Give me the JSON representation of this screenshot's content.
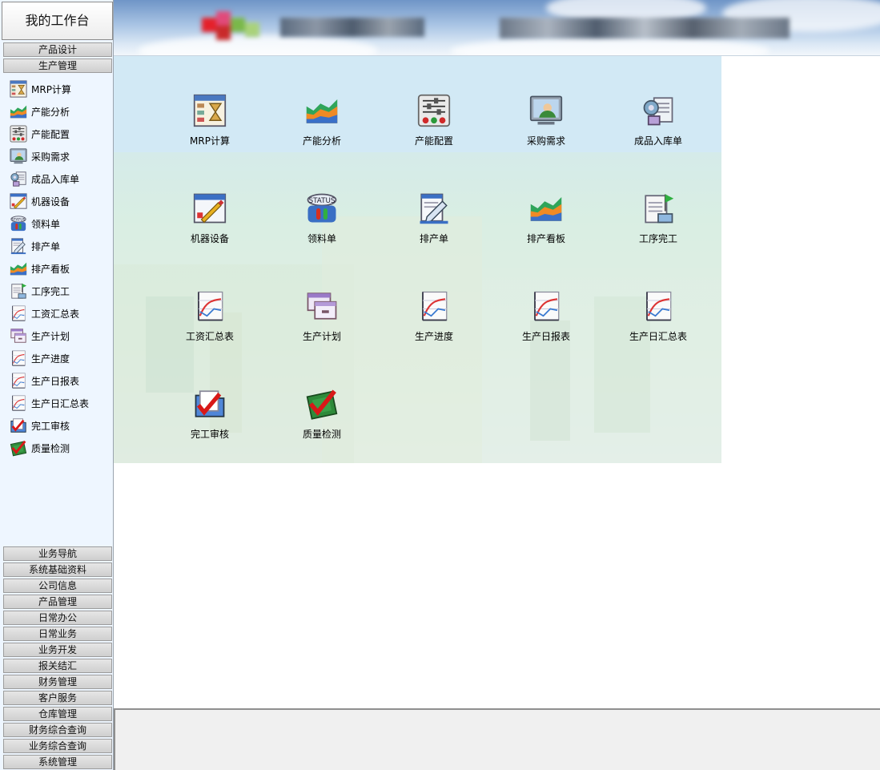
{
  "workbench": {
    "title": "我的工作台"
  },
  "top_categories": [
    "产品设计",
    "生产管理"
  ],
  "bottom_categories": [
    "业务导航",
    "系统基础资料",
    "公司信息",
    "产品管理",
    "日常办公",
    "日常业务",
    "业务开发",
    "报关结汇",
    "财务管理",
    "客户服务",
    "仓库管理",
    "财务综合查询",
    "业务综合查询",
    "系统管理"
  ],
  "sidebar": {
    "items": [
      {
        "label": "MRP计算",
        "icon": "hourglass-report-icon"
      },
      {
        "label": "产能分析",
        "icon": "area-chart-icon"
      },
      {
        "label": "产能配置",
        "icon": "sliders-icon"
      },
      {
        "label": "采购需求",
        "icon": "user-monitor-icon"
      },
      {
        "label": "成品入库单",
        "icon": "warehouse-doc-icon"
      },
      {
        "label": "机器设备",
        "icon": "pen-window-icon"
      },
      {
        "label": "领料单",
        "icon": "status-icon"
      },
      {
        "label": "排产单",
        "icon": "edit-doc-icon"
      },
      {
        "label": "排产看板",
        "icon": "area-chart-icon"
      },
      {
        "label": "工序完工",
        "icon": "flag-doc-icon"
      },
      {
        "label": "工资汇总表",
        "icon": "line-chart-icon"
      },
      {
        "label": "生产计划",
        "icon": "window-stack-icon"
      },
      {
        "label": "生产进度",
        "icon": "line-chart-icon"
      },
      {
        "label": "生产日报表",
        "icon": "line-chart-icon"
      },
      {
        "label": "生产日汇总表",
        "icon": "line-chart-icon"
      },
      {
        "label": "完工审核",
        "icon": "check-folder-icon"
      },
      {
        "label": "质量检测",
        "icon": "check-chip-icon"
      }
    ]
  },
  "desktop": {
    "tiles": [
      {
        "label": "MRP计算",
        "icon": "hourglass-report-icon"
      },
      {
        "label": "产能分析",
        "icon": "area-chart-icon"
      },
      {
        "label": "产能配置",
        "icon": "sliders-icon"
      },
      {
        "label": "采购需求",
        "icon": "user-monitor-icon"
      },
      {
        "label": "成品入库单",
        "icon": "warehouse-doc-icon"
      },
      {
        "label": "机器设备",
        "icon": "pen-window-icon"
      },
      {
        "label": "领料单",
        "icon": "status-icon"
      },
      {
        "label": "排产单",
        "icon": "edit-doc-icon"
      },
      {
        "label": "排产看板",
        "icon": "area-chart-icon"
      },
      {
        "label": "工序完工",
        "icon": "flag-doc-icon"
      },
      {
        "label": "工资汇总表",
        "icon": "line-chart-icon"
      },
      {
        "label": "生产计划",
        "icon": "window-stack-icon"
      },
      {
        "label": "生产进度",
        "icon": "line-chart-icon"
      },
      {
        "label": "生产日报表",
        "icon": "line-chart-icon"
      },
      {
        "label": "生产日汇总表",
        "icon": "line-chart-icon"
      },
      {
        "label": "完工审核",
        "icon": "check-folder-icon"
      },
      {
        "label": "质量检测",
        "icon": "check-chip-icon"
      }
    ]
  },
  "colors": {
    "sidebar_bg": "#eef6ff",
    "category_button": "#d6d6d6",
    "banner_sky": "#8fb3dc",
    "desktop_bg": "#d9eee3",
    "status_icon_red": "#d83020",
    "check_red": "#d81818"
  }
}
